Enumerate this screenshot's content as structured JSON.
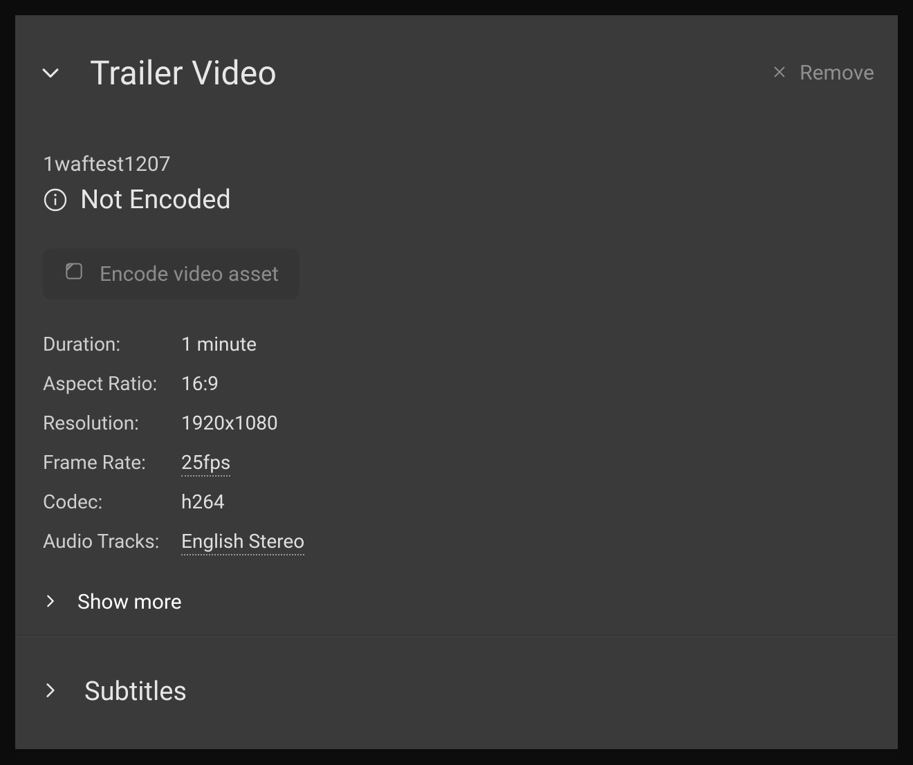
{
  "header": {
    "title": "Trailer Video",
    "remove_label": "Remove"
  },
  "asset": {
    "filename": "1waftest1207",
    "status": "Not Encoded",
    "encode_button": "Encode video asset"
  },
  "properties": {
    "duration_label": "Duration:",
    "duration_value": "1 minute",
    "aspect_label": "Aspect Ratio:",
    "aspect_value": "16:9",
    "resolution_label": "Resolution:",
    "resolution_value": "1920x1080",
    "framerate_label": "Frame Rate:",
    "framerate_value": "25fps",
    "codec_label": "Codec:",
    "codec_value": "h264",
    "audio_label": "Audio Tracks:",
    "audio_value": "English Stereo"
  },
  "show_more_label": "Show more",
  "subtitles": {
    "title": "Subtitles"
  }
}
